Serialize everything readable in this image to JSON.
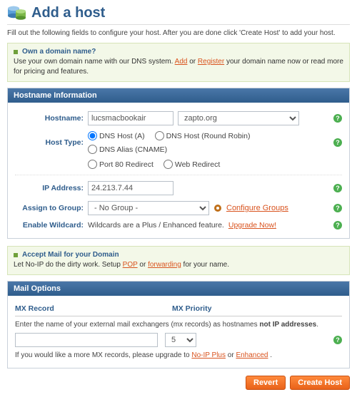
{
  "page": {
    "title": "Add a host",
    "intro": "Fill out the following fields to configure your host. After you are done click 'Create Host' to add your host."
  },
  "callout_domain": {
    "heading": "Own a domain name?",
    "body_pre": "Use your own domain name with our DNS system. ",
    "link_add": "Add",
    "body_mid": " or ",
    "link_register": "Register",
    "body_post": " your domain name now or read more for pricing and features."
  },
  "panel_hostname": {
    "title": "Hostname Information",
    "rows": {
      "hostname": {
        "label": "Hostname:",
        "value": "lucsmacbookair",
        "domain_selected": "zapto.org"
      },
      "hosttype": {
        "label": "Host Type:",
        "options": {
          "a": "DNS Host (A)",
          "rr": "DNS Host (Round Robin)",
          "cname": "DNS Alias (CNAME)",
          "port80": "Port 80 Redirect",
          "web": "Web Redirect"
        }
      },
      "ip": {
        "label": "IP Address:",
        "value": "24.213.7.44"
      },
      "group": {
        "label": "Assign to Group:",
        "selected": "- No Group -",
        "config_link": "Configure Groups"
      },
      "wildcard": {
        "label": "Enable Wildcard:",
        "text_pre": "Wildcards are a Plus / Enhanced feature. ",
        "link": "Upgrade Now!"
      }
    }
  },
  "callout_mail": {
    "heading": "Accept Mail for your Domain",
    "body_pre": "Let No-IP do the dirty work. Setup ",
    "link_pop": "POP",
    "body_mid": " or ",
    "link_fwd": "forwarding",
    "body_post": " for your name."
  },
  "panel_mail": {
    "title": "Mail Options",
    "col1": "MX Record",
    "col2": "MX Priority",
    "note_pre": "Enter the name of your external mail exchangers (mx records) as hostnames ",
    "note_bold": "not IP addresses",
    "note_post": ".",
    "mx_input_value": "",
    "mx_priority_value": "5",
    "upgrade_pre": "If you would like a more MX records, please upgrade to ",
    "upgrade_link1": "No-IP Plus",
    "upgrade_mid": " or ",
    "upgrade_link2": "Enhanced",
    "upgrade_post": "."
  },
  "buttons": {
    "revert": "Revert",
    "create": "Create Host"
  }
}
